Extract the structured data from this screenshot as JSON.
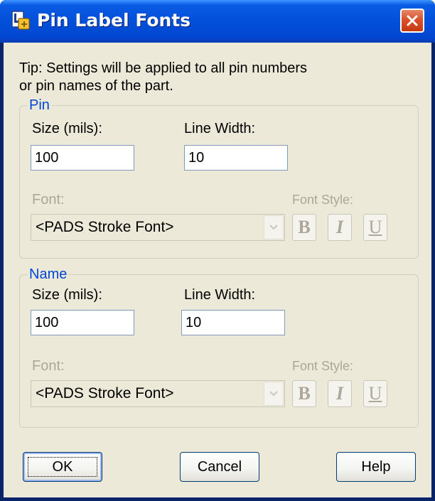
{
  "window": {
    "title": "Pin Label Fonts",
    "title_icon": "pin-label-app-icon",
    "close_icon": "close-icon"
  },
  "tip": {
    "line1": "Tip: Settings will be applied to all pin numbers",
    "line2": "or pin names of the part."
  },
  "pin_group": {
    "legend": "Pin",
    "size_label": "Size (mils):",
    "size_value": "100",
    "line_width_label": "Line Width:",
    "line_width_value": "10",
    "font_label": "Font:",
    "font_value": "<PADS Stroke Font>",
    "font_style_label": "Font Style:",
    "bold": "B",
    "italic": "I",
    "underline": "U"
  },
  "name_group": {
    "legend": "Name",
    "size_label": "Size (mils):",
    "size_value": "100",
    "line_width_label": "Line Width:",
    "line_width_value": "10",
    "font_label": "Font:",
    "font_value": "<PADS Stroke Font>",
    "font_style_label": "Font Style:",
    "bold": "B",
    "italic": "I",
    "underline": "U"
  },
  "buttons": {
    "ok": "OK",
    "cancel": "Cancel",
    "help": "Help"
  },
  "colors": {
    "titlebar": "#0350da",
    "dialog_face": "#ece9d8",
    "group_legend": "#0046d5",
    "disabled_text": "#aca899",
    "close_button": "#d9522c"
  }
}
